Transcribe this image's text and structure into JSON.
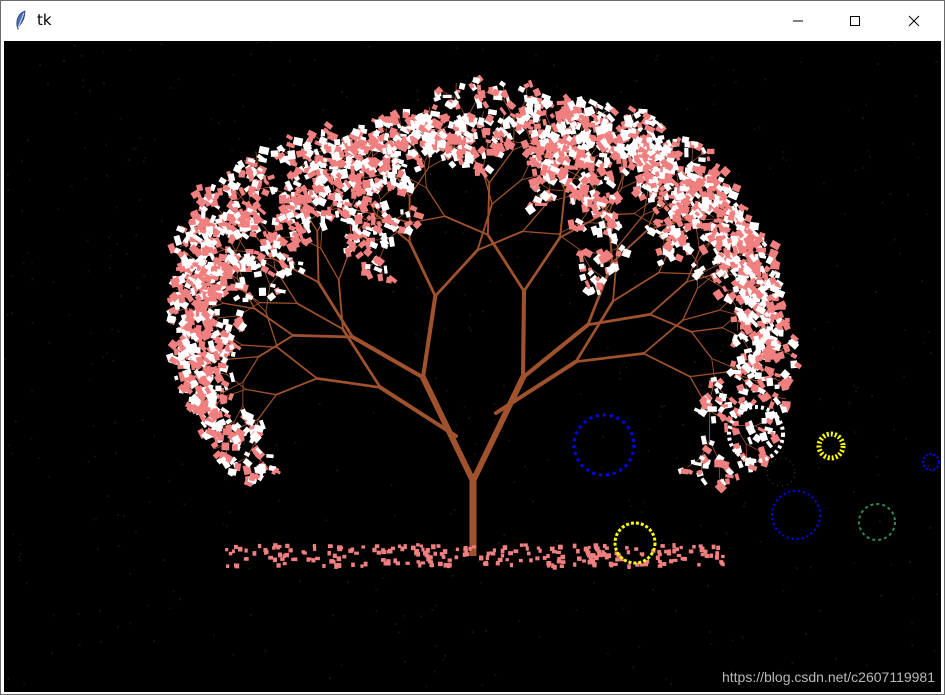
{
  "window": {
    "title": "tk",
    "icon": "feather-icon",
    "controls": [
      "minimize-icon",
      "maximize-icon",
      "close-icon"
    ]
  },
  "colors": {
    "canvas_bg": "#000000",
    "trunk": "#a0522d",
    "petal_pink": "#f08080",
    "petal_white": "#ffffff",
    "circle_blue": "#0000ff",
    "circle_white": "#ffffff",
    "circle_yellow": "#ffff00",
    "circle_green": "#2e8b57"
  },
  "watermark": {
    "text": "https://blog.csdn.net/c2607119981"
  }
}
